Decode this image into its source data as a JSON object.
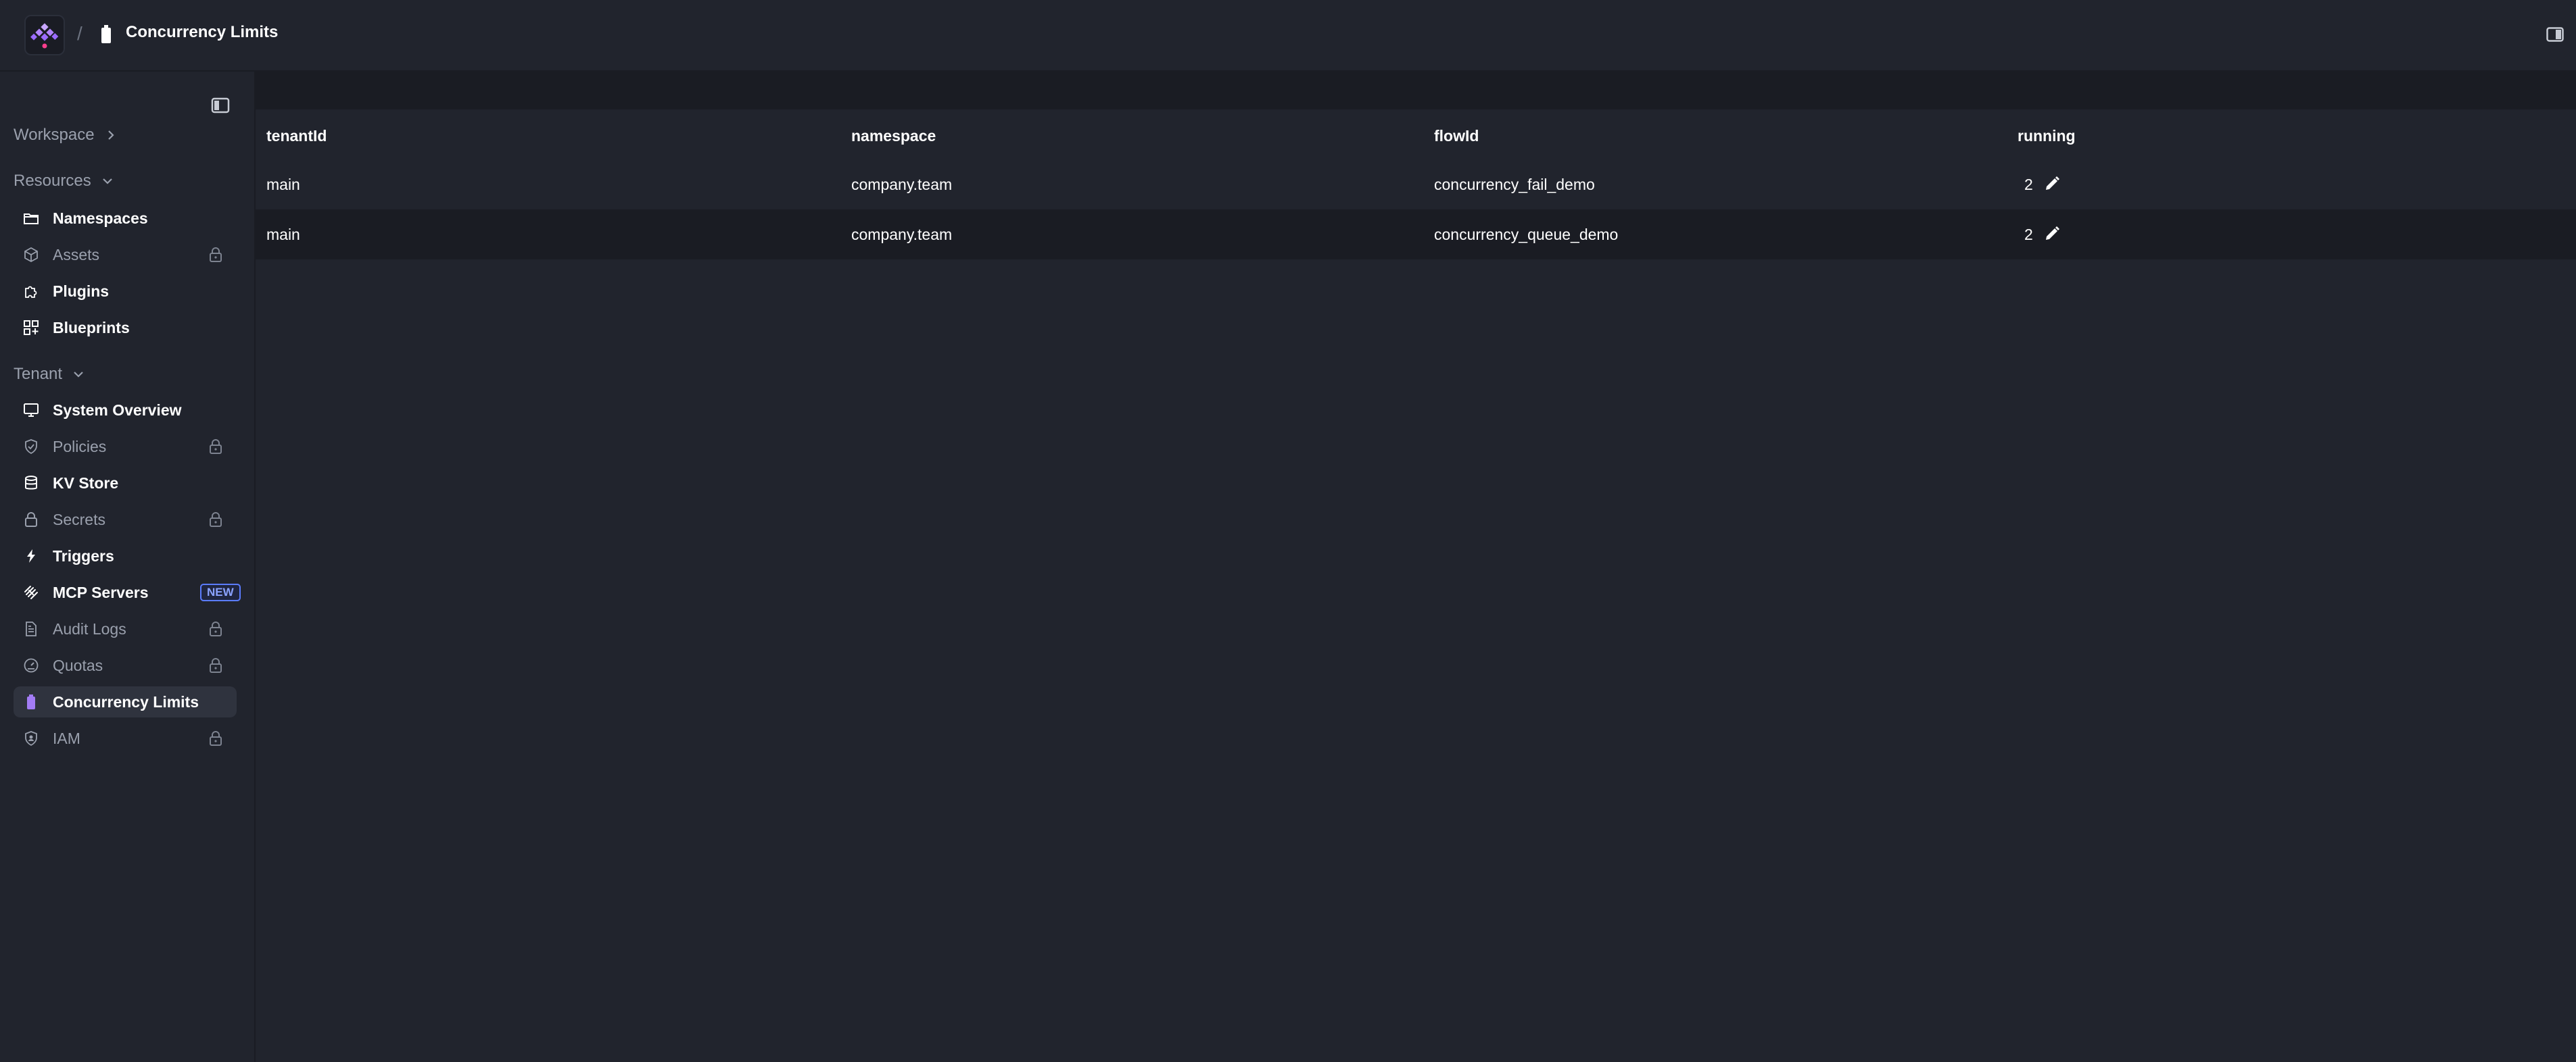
{
  "header": {
    "separator": "/",
    "page_title": "Concurrency Limits"
  },
  "sidebar": {
    "workspace_label": "Workspace",
    "resources_label": "Resources",
    "tenant_label": "Tenant",
    "resources": [
      {
        "label": "Namespaces",
        "icon": "folder-icon",
        "locked": false
      },
      {
        "label": "Assets",
        "icon": "cube-icon",
        "locked": true
      },
      {
        "label": "Plugins",
        "icon": "puzzle-icon",
        "locked": false
      },
      {
        "label": "Blueprints",
        "icon": "blueprint-icon",
        "locked": false
      }
    ],
    "tenant": [
      {
        "label": "System Overview",
        "icon": "monitor-icon",
        "locked": false
      },
      {
        "label": "Policies",
        "icon": "shield-check-icon",
        "locked": true
      },
      {
        "label": "KV Store",
        "icon": "database-icon",
        "locked": false
      },
      {
        "label": "Secrets",
        "icon": "lock-icon",
        "locked": true
      },
      {
        "label": "Triggers",
        "icon": "lightning-icon",
        "locked": false
      },
      {
        "label": "MCP Servers",
        "icon": "mcp-icon",
        "locked": false,
        "badge": "NEW"
      },
      {
        "label": "Audit Logs",
        "icon": "file-text-icon",
        "locked": true
      },
      {
        "label": "Quotas",
        "icon": "gauge-icon",
        "locked": true
      },
      {
        "label": "Concurrency Limits",
        "icon": "battery-icon",
        "locked": false,
        "active": true
      },
      {
        "label": "IAM",
        "icon": "user-shield-icon",
        "locked": true
      }
    ]
  },
  "table": {
    "columns": [
      "tenantId",
      "namespace",
      "flowId",
      "running"
    ],
    "rows": [
      {
        "tenantId": "main",
        "namespace": "company.team",
        "flowId": "concurrency_fail_demo",
        "running": "2"
      },
      {
        "tenantId": "main",
        "namespace": "company.team",
        "flowId": "concurrency_queue_demo",
        "running": "2"
      }
    ]
  },
  "colors": {
    "background": "#21242d",
    "sidebar_active": "#2f333e",
    "accent_purple": "#a37cf5",
    "badge_blue": "#5b7cff"
  }
}
